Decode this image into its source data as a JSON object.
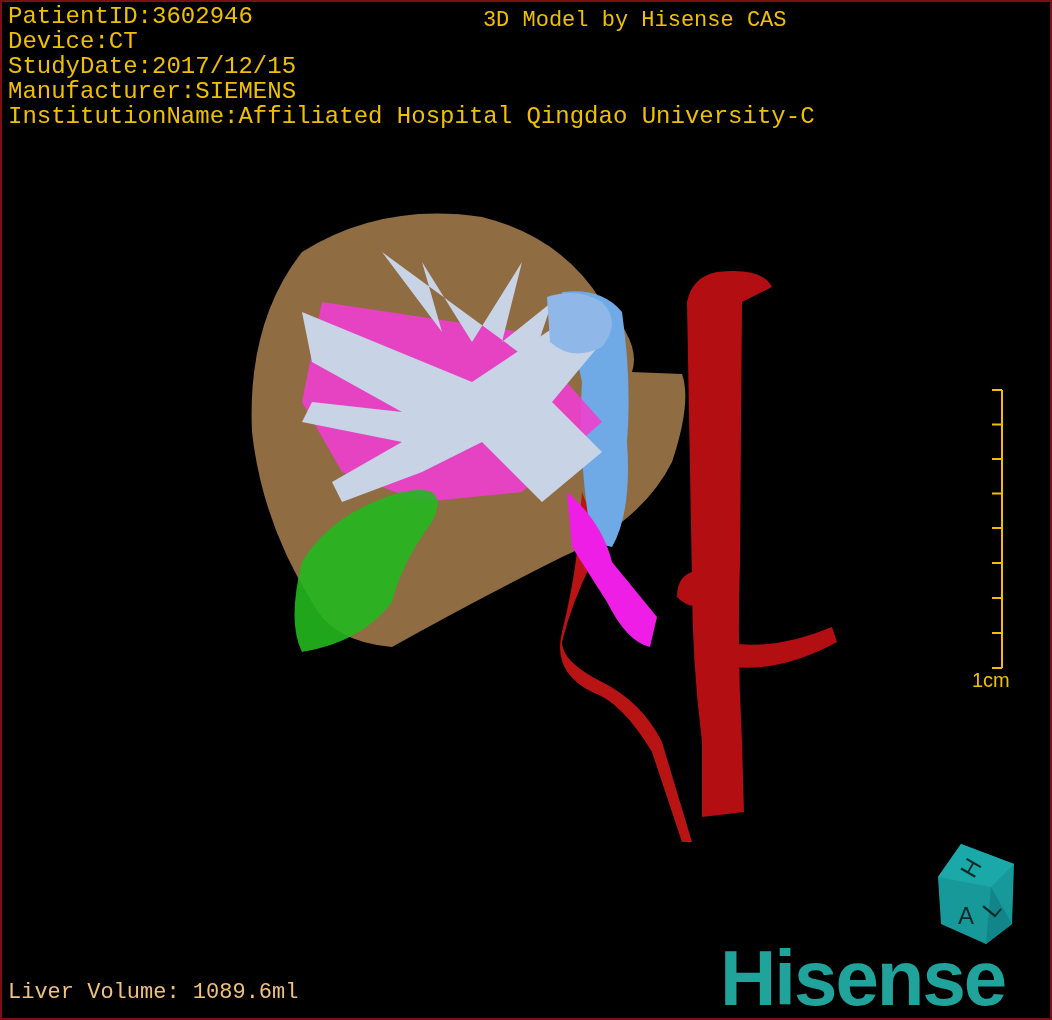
{
  "patient_info": [
    "PatientID:3602946",
    "Device:CT",
    "StudyDate:2017/12/15",
    "Manufacturer:SIEMENS",
    "InstitutionName:Affiliated Hospital Qingdao University-C"
  ],
  "model_credit": "3D Model by Hisense CAS",
  "scale_bar": {
    "label": "1cm"
  },
  "orientation_cube": {
    "labels": [
      "H",
      "A",
      "L"
    ]
  },
  "liver_volume": "Liver Volume: 1089.6ml",
  "logo": "Hisense"
}
